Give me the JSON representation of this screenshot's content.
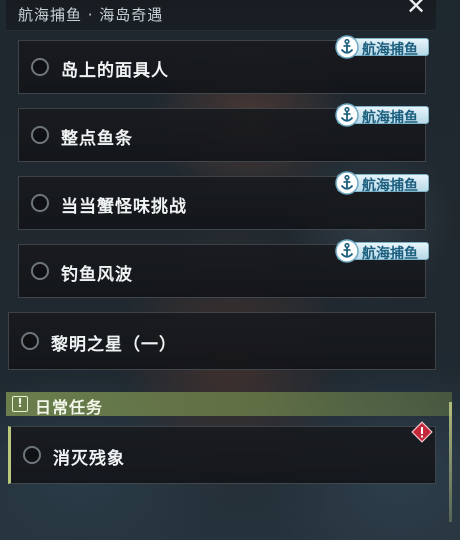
{
  "header": {
    "title": "航海捕鱼 · 海岛奇遇",
    "close_glyph": "✕"
  },
  "quests": [
    {
      "label": "岛上的面具人",
      "tag": "航海捕鱼",
      "tag_icon": "anchor-icon"
    },
    {
      "label": "整点鱼条",
      "tag": "航海捕鱼",
      "tag_icon": "anchor-icon"
    },
    {
      "label": "当当蟹怪味挑战",
      "tag": "航海捕鱼",
      "tag_icon": "anchor-icon"
    },
    {
      "label": "钓鱼风波",
      "tag": "航海捕鱼",
      "tag_icon": "anchor-icon"
    },
    {
      "label": "黎明之星（一）"
    }
  ],
  "daily_section": {
    "icon_glyph": "!",
    "title": "日常任务",
    "accent_color": "#8a9c5a",
    "items": [
      {
        "label": "消灭残象",
        "badge_icon": "warning-diamond-icon"
      }
    ]
  },
  "colors": {
    "tag_text": "#1d5f7e",
    "warning": "#c2283a"
  }
}
